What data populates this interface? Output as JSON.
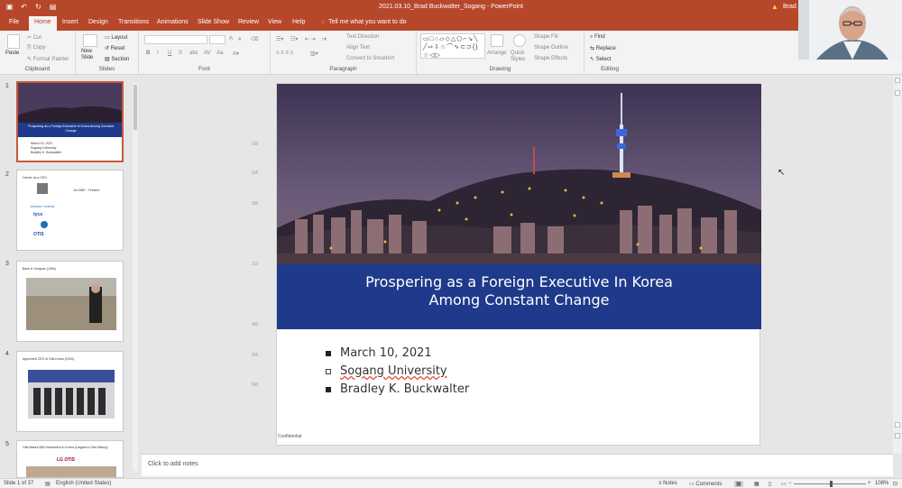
{
  "window": {
    "title": "2021.03.10_Brad Buckwalter_Sogang  -  PowerPoint",
    "user": "Brad",
    "quick_access": [
      "save-icon",
      "undo-icon",
      "redo-icon",
      "presenter-icon"
    ]
  },
  "tabs": [
    "File",
    "Home",
    "Insert",
    "Design",
    "Transitions",
    "Animations",
    "Slide Show",
    "Review",
    "View",
    "Help"
  ],
  "active_tab": "Home",
  "tell_me": "Tell me what you want to do",
  "ribbon": {
    "clipboard": {
      "label": "Clipboard",
      "paste": "Paste",
      "cut": "Cut",
      "copy": "Copy",
      "format_painter": "Format Painter"
    },
    "slides": {
      "label": "Slides",
      "new_slide": "New Slide",
      "layout": "Layout",
      "reset": "Reset",
      "section": "Section"
    },
    "font": {
      "label": "Font",
      "bold": "B",
      "italic": "I",
      "underline": "U",
      "strike": "S",
      "shadow": "abc",
      "spacing": "AV",
      "case": "Aa",
      "grow": "A",
      "shrink": "A"
    },
    "paragraph": {
      "label": "Paragraph",
      "text_direction": "Text Direction",
      "align_text": "Align Text",
      "smartart": "Convert to SmartArt"
    },
    "drawing": {
      "label": "Drawing",
      "arrange": "Arrange",
      "quick_styles": "Quick Styles",
      "shape_fill": "Shape Fill",
      "shape_outline": "Shape Outline",
      "shape_effects": "Shape Effects"
    },
    "editing": {
      "label": "Editing",
      "find": "Find",
      "replace": "Replace",
      "select": "Select"
    }
  },
  "thumbnails": [
    {
      "number": "1",
      "selected": true,
      "title": "Prospering as a Foreign Executive In Korea Among Constant Change",
      "lines": [
        "March 10, 2021",
        "Sogang University",
        "Bradley K. Buckwalter"
      ]
    },
    {
      "number": "2",
      "selected": false,
      "title": "Career as a CEO",
      "lines": [
        "Jul 1989 ~ Present",
        "Johnson Controls",
        "tyco",
        "OTIS"
      ]
    },
    {
      "number": "3",
      "selected": false,
      "title": "Back in Yongsan (1984)",
      "lines": []
    },
    {
      "number": "4",
      "selected": false,
      "title": "Appointed CEO of Otis Korea (1994)",
      "lines": []
    },
    {
      "number": "5",
      "selected": false,
      "title": "Otis Makes $1B Investment in Korea (Largest in Otis History)",
      "lines": [
        "LG OTIS"
      ]
    }
  ],
  "slide": {
    "title_line1": "Prospering as a Foreign Executive In Korea",
    "title_line2": "Among Constant Change",
    "bullets": [
      "March 10,  2021",
      "Sogang University",
      "Bradley K. Buckwalter"
    ],
    "footer": "Confidential",
    "banner_color": "#1f3a8a"
  },
  "ruler": [
    "1/8",
    "1/4",
    "3/8",
    "1/2",
    "4/8",
    "3/4",
    "5/8"
  ],
  "notes_placeholder": "Click to add notes",
  "status": {
    "slide_info": "Slide 1 of 37",
    "language": "English (United States)",
    "notes": "Notes",
    "comments": "Comments",
    "zoom": "108%"
  },
  "colors": {
    "accent": "#b7472a",
    "selected_thumb_border": "#c55a3a"
  }
}
